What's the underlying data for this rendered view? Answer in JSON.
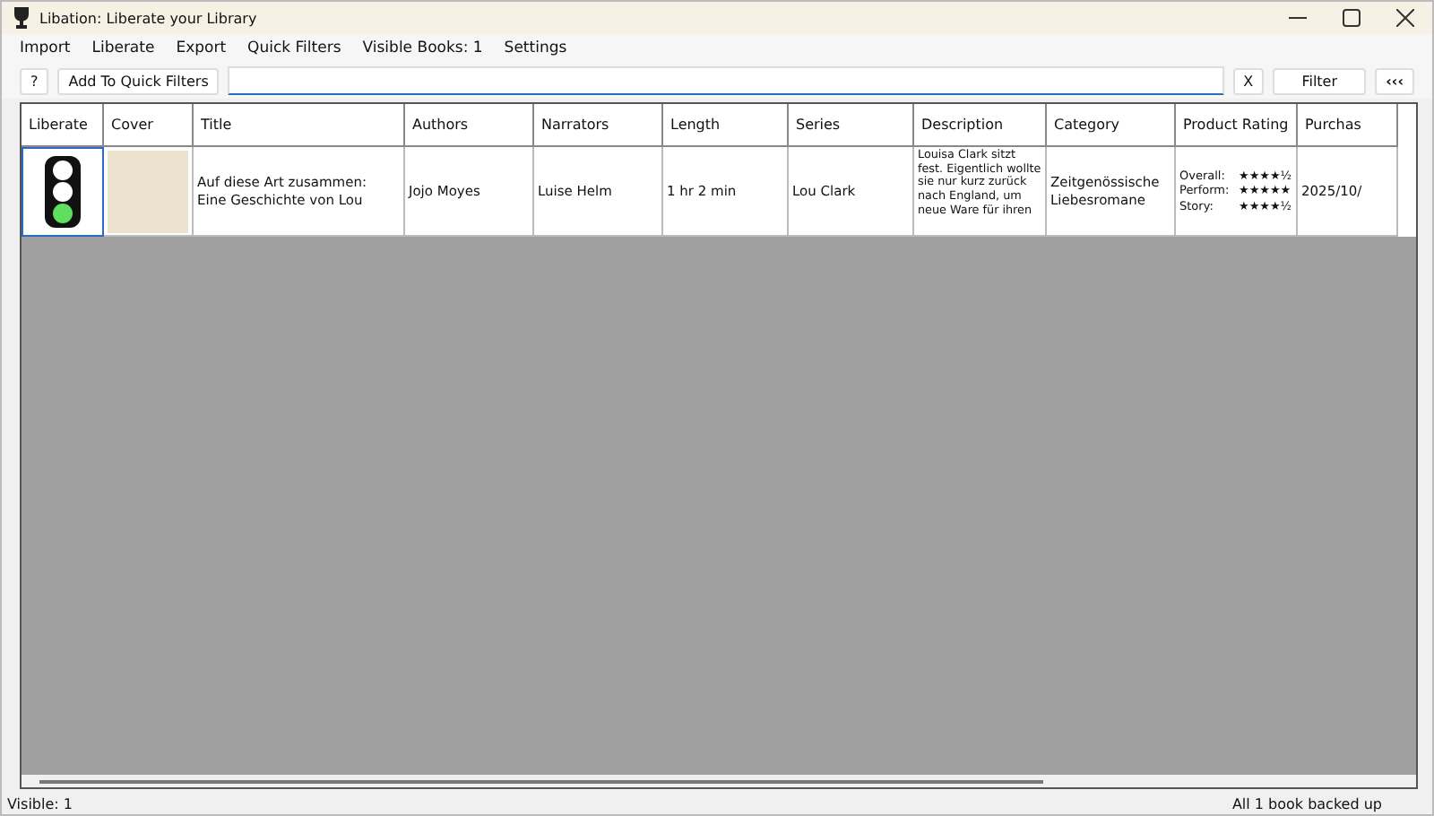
{
  "window": {
    "title": "Libation: Liberate your Library"
  },
  "menu": [
    "Import",
    "Liberate",
    "Export",
    "Quick Filters",
    "Visible Books: 1",
    "Settings"
  ],
  "toolbar": {
    "help": "?",
    "add_quick_filter": "Add To Quick Filters",
    "clear": "X",
    "filter": "Filter",
    "collapse": "‹‹‹"
  },
  "table": {
    "columns": [
      "Liberate",
      "Cover",
      "Title",
      "Authors",
      "Narrators",
      "Length",
      "Series",
      "Description",
      "Category",
      "Product Rating",
      "Purchas"
    ],
    "rows": [
      {
        "title": "Auf diese Art zusammen: Eine Geschichte von Lou",
        "authors": "Jojo Moyes",
        "narrators": "Luise Helm",
        "length": "1 hr 2 min",
        "series": "Lou Clark",
        "description": "Louisa Clark sitzt fest. Eigentlich wollte sie nur kurz zurück nach England, um neue Ware für ihren",
        "category": "Zeitgenössische Liebesromane",
        "ratings": [
          {
            "label": "Overall:",
            "stars": "★★★★½"
          },
          {
            "label": "Perform:",
            "stars": "★★★★★"
          },
          {
            "label": "Story:",
            "stars": "★★★★½"
          }
        ],
        "purchase_date": "2025/10/",
        "selected": true
      }
    ]
  },
  "status_bar": {
    "left": "Visible: 1",
    "right": "All 1 book backed up"
  }
}
